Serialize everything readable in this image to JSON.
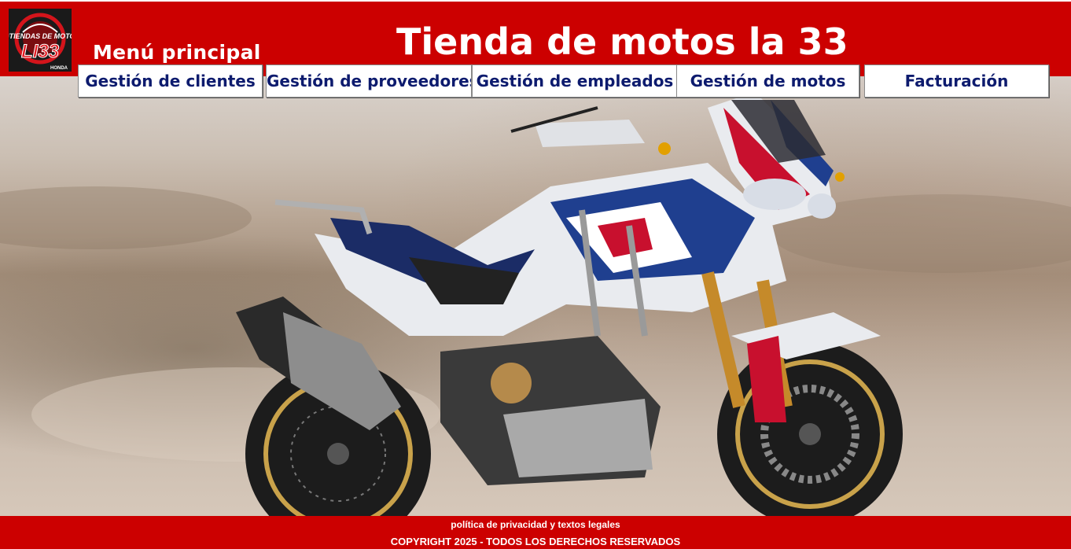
{
  "header": {
    "title": "Tienda de motos la 33",
    "menu_label": "Menú principal",
    "logo": {
      "text_top": "#TIENDAS DE MOTO",
      "text_main": "LI33",
      "brand": "HONDA"
    }
  },
  "nav": {
    "items": [
      {
        "label": "Gestión de clientes"
      },
      {
        "label": "Gestión de proveedores"
      },
      {
        "label": "Gestión de empleados"
      },
      {
        "label": "Gestión de motos"
      },
      {
        "label": "Facturación"
      }
    ]
  },
  "footer": {
    "privacy_link": "política de privacidad y textos legales",
    "copyright": "COPYRIGHT 2025 - TODOS LOS DERECHOS RESERVADOS"
  },
  "colors": {
    "header_bg": "#cc0000",
    "footer_bg": "#cc0000",
    "nav_text": "#0d1b6e",
    "title_text": "#ffffff"
  }
}
